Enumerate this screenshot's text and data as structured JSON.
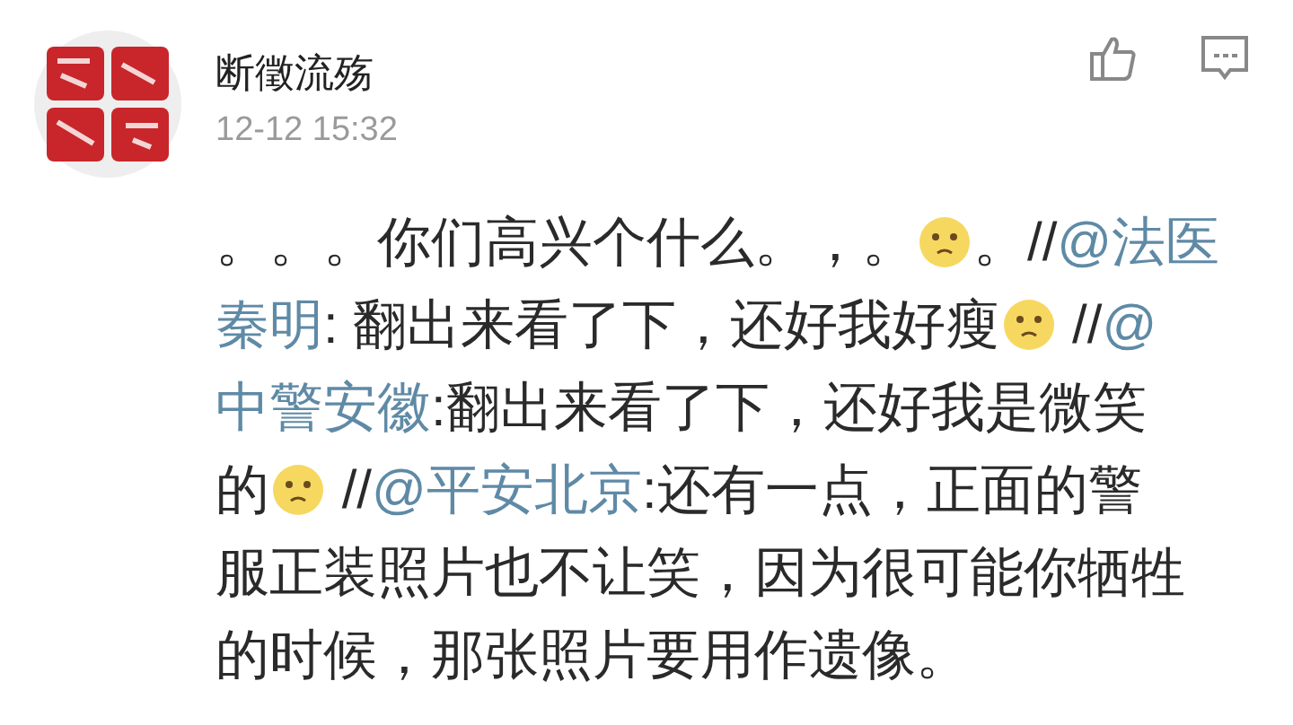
{
  "comment": {
    "author": "断徵流殇",
    "time": "12-12 15:32",
    "lines": [
      [
        {
          "kind": "text",
          "text": "。。。你们高兴个什么。，。"
        },
        {
          "kind": "emoji"
        },
        {
          "kind": "text",
          "text": "。//"
        },
        {
          "kind": "mention",
          "text": "@法医"
        }
      ],
      [
        {
          "kind": "mention",
          "text": "秦明"
        },
        {
          "kind": "text",
          "text": ": 翻出来看了下，还好我好瘦"
        },
        {
          "kind": "emoji"
        },
        {
          "kind": "text",
          "text": " //"
        },
        {
          "kind": "mention",
          "text": "@"
        }
      ],
      [
        {
          "kind": "mention",
          "text": "中警安徽"
        },
        {
          "kind": "text",
          "text": ":翻出来看了下，还好我是微笑"
        }
      ],
      [
        {
          "kind": "text",
          "text": "的"
        },
        {
          "kind": "emoji"
        },
        {
          "kind": "text",
          "text": " //"
        },
        {
          "kind": "mention",
          "text": "@平安北京"
        },
        {
          "kind": "text",
          "text": ":还有一点，正面的警"
        }
      ],
      [
        {
          "kind": "text",
          "text": "服正装照片也不让笑，因为很可能你牺牲"
        }
      ],
      [
        {
          "kind": "text",
          "text": "的时候，那张照片要用作遗像。"
        }
      ]
    ]
  }
}
